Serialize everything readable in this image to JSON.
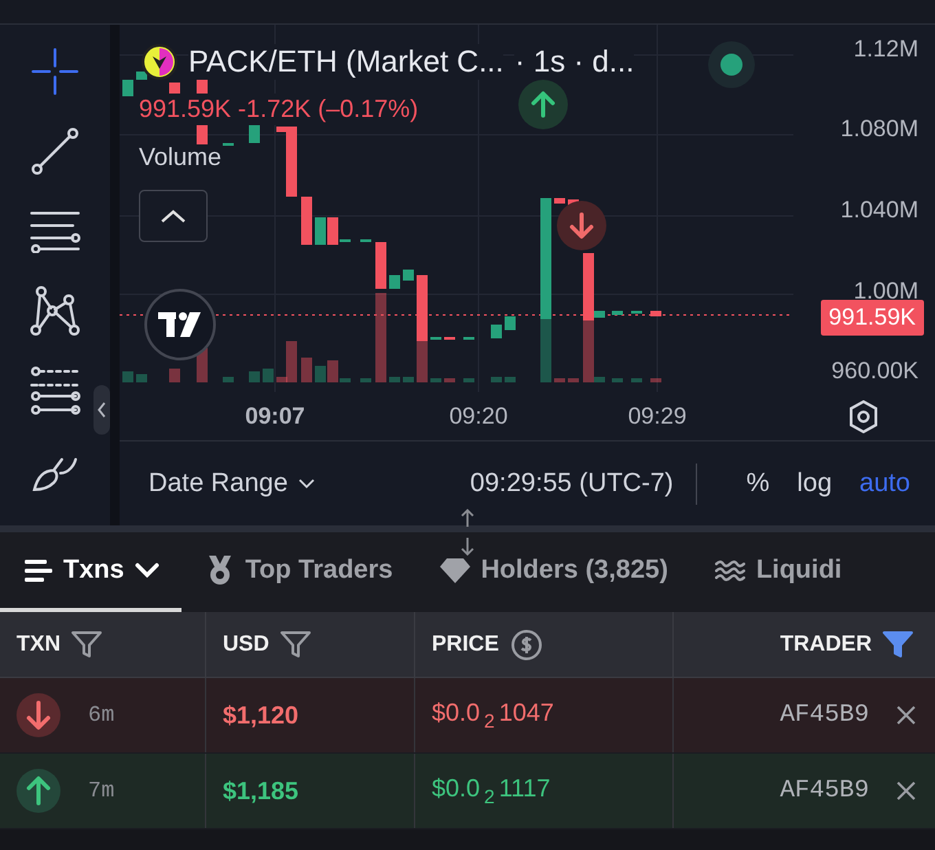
{
  "toolbar": {
    "tools": [
      {
        "kind": "crosshair",
        "selected": true
      },
      {
        "kind": "trend-line",
        "selected": false
      },
      {
        "kind": "lines",
        "selected": false
      },
      {
        "kind": "pattern",
        "selected": false
      },
      {
        "kind": "fib",
        "selected": false
      },
      {
        "kind": "brush",
        "selected": false
      }
    ]
  },
  "chart": {
    "symbol": "PACK/ETH (Market C...",
    "interval": "· 1s · d...",
    "live": true,
    "legend": "991.59K -1.72K (–0.17%)",
    "volume_label": "Volume",
    "price_ticks": [
      "1.12M",
      "1.080M",
      "1.040M",
      "1.00M",
      "960.00K"
    ],
    "time_labels": [
      {
        "label": "09:07",
        "bold": true
      },
      {
        "label": "09:20",
        "bold": false
      },
      {
        "label": "09:29",
        "bold": false
      }
    ],
    "last_price": "991.59K",
    "markers": [
      {
        "kind": "buy"
      },
      {
        "kind": "sell"
      }
    ]
  },
  "footer": {
    "date_range": "Date Range",
    "time": "09:29:55 (UTC-7)",
    "scales": [
      {
        "label": "%",
        "selected": false
      },
      {
        "label": "log",
        "selected": false
      },
      {
        "label": "auto",
        "selected": true
      }
    ]
  },
  "tabs": [
    {
      "kind": "txns",
      "label": "Txns",
      "selected": true
    },
    {
      "kind": "traders",
      "label": "Top Traders",
      "selected": false
    },
    {
      "kind": "holders",
      "label": "Holders (3,825)",
      "selected": false
    },
    {
      "kind": "liquidity",
      "label": "Liquidi",
      "selected": false
    }
  ],
  "table": {
    "columns": [
      {
        "label": "TXN",
        "kind": "filter",
        "active": false
      },
      {
        "label": "USD",
        "kind": "filter",
        "active": false
      },
      {
        "label": "PRICE",
        "kind": "currency"
      },
      {
        "label": "TRADER",
        "kind": "filter",
        "active": true
      }
    ],
    "rows": [
      {
        "kind": "sell",
        "age": "6m",
        "usd": "$1,120",
        "price": "$0.0$_{2}$1047",
        "trader": "AF45B9"
      },
      {
        "kind": "buy",
        "age": "7m",
        "usd": "$1,185",
        "price": "$0.0$_{2}$1117",
        "trader": "AF45B9"
      }
    ]
  }
}
